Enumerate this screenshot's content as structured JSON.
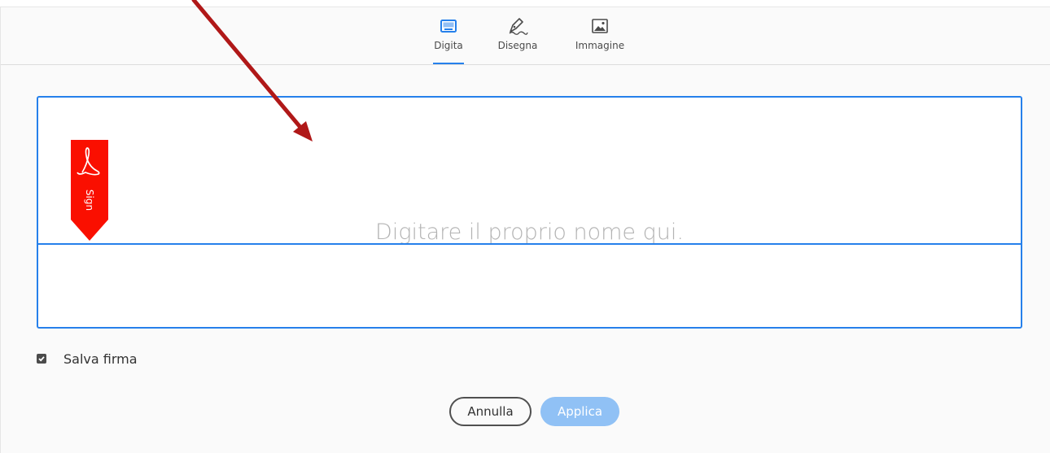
{
  "tabs": [
    {
      "label": "Digita",
      "icon": "keyboard-icon",
      "active": true
    },
    {
      "label": "Disegna",
      "icon": "pen-draw-icon",
      "active": false
    },
    {
      "label": "Immagine",
      "icon": "image-icon",
      "active": false
    }
  ],
  "signature": {
    "placeholder": "Digitare il proprio nome qui.",
    "badge_text": "Sign"
  },
  "save_signature": {
    "label": "Salva firma",
    "checked": true
  },
  "buttons": {
    "cancel": "Annulla",
    "apply": "Applica"
  },
  "colors": {
    "accent": "#2680eb",
    "apply_disabled": "#90c1f5",
    "adobe_red": "#fa0f00",
    "annotation_arrow": "#b01818"
  }
}
